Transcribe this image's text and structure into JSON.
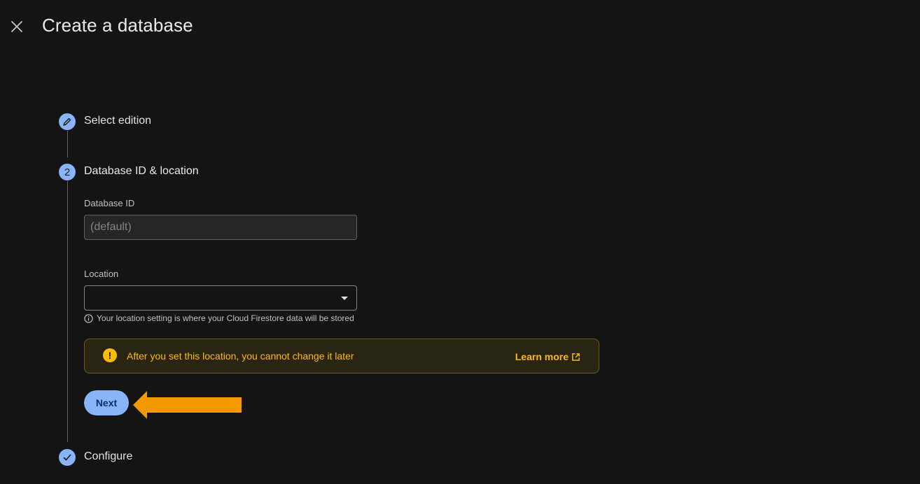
{
  "header": {
    "title": "Create a database",
    "close_icon": "close-icon"
  },
  "steps": [
    {
      "label": "Select edition",
      "indicator": "pencil-icon",
      "state": "completed"
    },
    {
      "label": "Database ID & location",
      "indicator": "2",
      "state": "active"
    },
    {
      "label": "Configure",
      "indicator": "check-icon",
      "state": "pending"
    }
  ],
  "form": {
    "database_id": {
      "label": "Database ID",
      "placeholder": "(default)",
      "value": ""
    },
    "location": {
      "label": "Location",
      "value": "",
      "hint": "Your location setting is where your Cloud Firestore data will be stored",
      "hint_icon": "info-icon"
    }
  },
  "warning": {
    "icon": "warning-icon",
    "text": "After you set this location, you cannot change it later",
    "link_label": "Learn more",
    "link_icon": "external-link-icon"
  },
  "actions": {
    "next_label": "Next"
  },
  "annotation": {
    "icon": "arrow-left-icon",
    "color": "#f29900"
  },
  "colors": {
    "accent": "#8ab4f8",
    "warning": "#fbbc04",
    "background": "#141414"
  }
}
